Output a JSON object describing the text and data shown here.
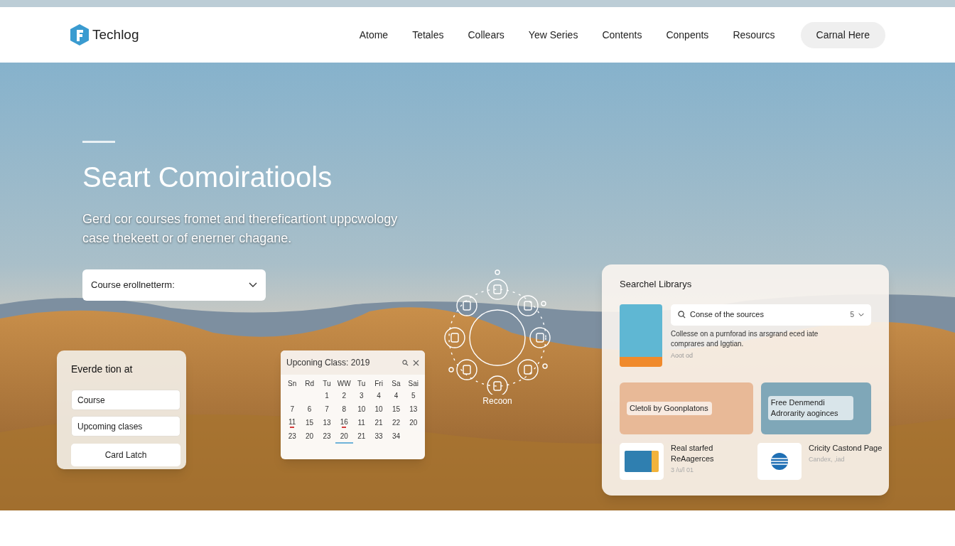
{
  "nav": {
    "brand": "Techlog",
    "links": [
      "Atome",
      "Tetales",
      "Collears",
      "Yew Series",
      "Contents",
      "Conpents",
      "Resourcs"
    ],
    "cta": "Carnal Here"
  },
  "hero": {
    "title": "Seart Comoiratiools",
    "subtitle": "Gerd cor courses fromet and thereficartiont uppcwology case thekeett or of enerner chagane.",
    "select": {
      "value": "Course erollnetterm:"
    }
  },
  "form_card": {
    "title": "Everde tion at",
    "fields": [
      {
        "value": "Course"
      },
      {
        "value": "Upcoming clases"
      }
    ],
    "button": "Card Latch"
  },
  "calendar": {
    "title": "Upconing Class: 2019",
    "weekdays": [
      "Sn",
      "Rd",
      "Tu",
      "WW",
      "Tu",
      "Fri",
      "Sa",
      "Sai"
    ],
    "days": [
      {
        "day": "1",
        "selected": false,
        "event": false
      },
      {
        "day": "2",
        "selected": false,
        "event": false
      },
      {
        "day": "3",
        "selected": false,
        "event": false
      },
      {
        "day": "4",
        "selected": false,
        "event": false
      },
      {
        "day": "4",
        "selected": false,
        "event": false
      },
      {
        "day": "5",
        "selected": false,
        "event": false
      },
      {
        "day": "7",
        "selected": false,
        "event": false
      },
      {
        "day": "6",
        "selected": false,
        "event": false
      },
      {
        "day": "7",
        "selected": false,
        "event": false
      },
      {
        "day": "8",
        "selected": false,
        "event": false
      },
      {
        "day": "10",
        "selected": false,
        "event": false
      },
      {
        "day": "10",
        "selected": false,
        "event": false
      },
      {
        "day": "15",
        "selected": false,
        "event": false
      },
      {
        "day": "13",
        "selected": false,
        "event": false
      },
      {
        "day": "11",
        "selected": false,
        "event": true
      },
      {
        "day": "15",
        "selected": false,
        "event": false
      },
      {
        "day": "13",
        "selected": false,
        "event": false
      },
      {
        "day": "16",
        "selected": false,
        "event": true
      },
      {
        "day": "11",
        "selected": false,
        "event": false
      },
      {
        "day": "21",
        "selected": false,
        "event": false
      },
      {
        "day": "22",
        "selected": false,
        "event": false
      },
      {
        "day": "20",
        "selected": false,
        "event": false
      },
      {
        "day": "23",
        "selected": false,
        "event": false
      },
      {
        "day": "20",
        "selected": false,
        "event": false
      },
      {
        "day": "23",
        "selected": false,
        "event": false
      },
      {
        "day": "20",
        "selected": true,
        "event": false
      },
      {
        "day": "21",
        "selected": false,
        "event": false
      },
      {
        "day": "33",
        "selected": false,
        "event": false
      },
      {
        "day": "34",
        "selected": false,
        "event": false
      }
    ]
  },
  "orbit": {
    "label": "Recoon"
  },
  "library": {
    "title": "Searchel Librarys",
    "search": {
      "value": "Conse of the sources",
      "count": "5"
    },
    "description": "Collesse on a purnforad ins arsgrand eced iate comprares and Iggtian.",
    "meta": "Aoot od",
    "tiles": [
      {
        "caption": "Cletoli by Goonplatons"
      },
      {
        "caption": "Free Denmendi Adrorarity aoginces"
      }
    ],
    "items": [
      {
        "title": "Real starfed ReAagerces",
        "meta": "3 /u/l 01"
      },
      {
        "title": "Cricity Castond Page",
        "meta": "Candex, ,iad"
      }
    ]
  }
}
